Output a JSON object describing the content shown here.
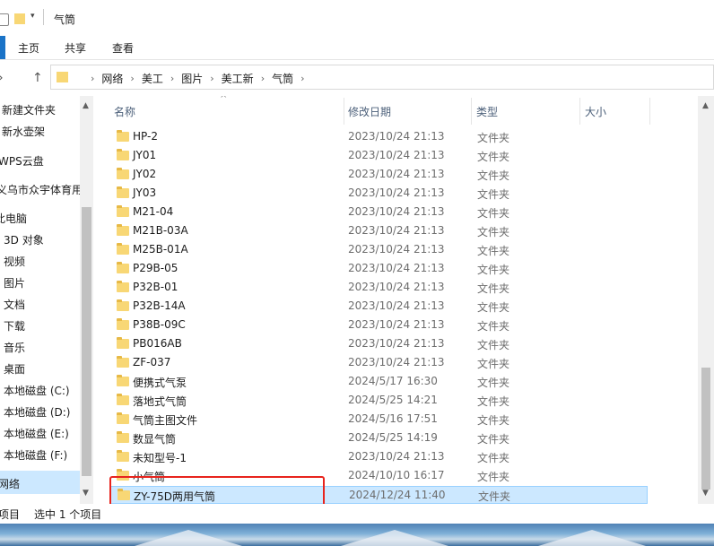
{
  "window": {
    "title": "气筒"
  },
  "ribbon": {
    "tabs": [
      "主页",
      "共享",
      "查看"
    ]
  },
  "address": {
    "crumbs": [
      "网络",
      "美工",
      "图片",
      "美工新",
      "气筒"
    ]
  },
  "nav": {
    "items": [
      "新建文件夹",
      "新水壶架",
      "WPS云盘",
      "义乌市众宇体育用",
      "此电脑",
      "3D 对象",
      "视频",
      "图片",
      "文档",
      "下载",
      "音乐",
      "桌面",
      "本地磁盘 (C:)",
      "本地磁盘 (D:)",
      "本地磁盘 (E:)",
      "本地磁盘 (F:)",
      "网络"
    ]
  },
  "columns": {
    "name": "名称",
    "date": "修改日期",
    "type": "类型",
    "size": "大小"
  },
  "files": [
    {
      "name": "HP-2",
      "date": "2023/10/24 21:13",
      "type": "文件夹"
    },
    {
      "name": "JY01",
      "date": "2023/10/24 21:13",
      "type": "文件夹"
    },
    {
      "name": "JY02",
      "date": "2023/10/24 21:13",
      "type": "文件夹"
    },
    {
      "name": "JY03",
      "date": "2023/10/24 21:13",
      "type": "文件夹"
    },
    {
      "name": "M21-04",
      "date": "2023/10/24 21:13",
      "type": "文件夹"
    },
    {
      "name": "M21B-03A",
      "date": "2023/10/24 21:13",
      "type": "文件夹"
    },
    {
      "name": "M25B-01A",
      "date": "2023/10/24 21:13",
      "type": "文件夹"
    },
    {
      "name": "P29B-05",
      "date": "2023/10/24 21:13",
      "type": "文件夹"
    },
    {
      "name": "P32B-01",
      "date": "2023/10/24 21:13",
      "type": "文件夹"
    },
    {
      "name": "P32B-14A",
      "date": "2023/10/24 21:13",
      "type": "文件夹"
    },
    {
      "name": "P38B-09C",
      "date": "2023/10/24 21:13",
      "type": "文件夹"
    },
    {
      "name": "PB016AB",
      "date": "2023/10/24 21:13",
      "type": "文件夹"
    },
    {
      "name": "ZF-037",
      "date": "2023/10/24 21:13",
      "type": "文件夹"
    },
    {
      "name": "便携式气泵",
      "date": "2024/5/17 16:30",
      "type": "文件夹"
    },
    {
      "name": "落地式气筒",
      "date": "2024/5/25 14:21",
      "type": "文件夹"
    },
    {
      "name": "气筒主图文件",
      "date": "2024/5/16 17:51",
      "type": "文件夹"
    },
    {
      "name": "数显气筒",
      "date": "2024/5/25 14:19",
      "type": "文件夹"
    },
    {
      "name": "未知型号-1",
      "date": "2023/10/24 21:13",
      "type": "文件夹"
    },
    {
      "name": "小气筒",
      "date": "2024/10/10 16:17",
      "type": "文件夹"
    },
    {
      "name": "ZY-75D两用气筒",
      "date": "2024/12/24 11:40",
      "type": "文件夹"
    }
  ],
  "status": {
    "count": "项目",
    "selection": "选中 1 个项目"
  },
  "colors": {
    "selection": "#cce8ff",
    "highlight_box": "#e8241d",
    "folder": "#f8d775"
  }
}
